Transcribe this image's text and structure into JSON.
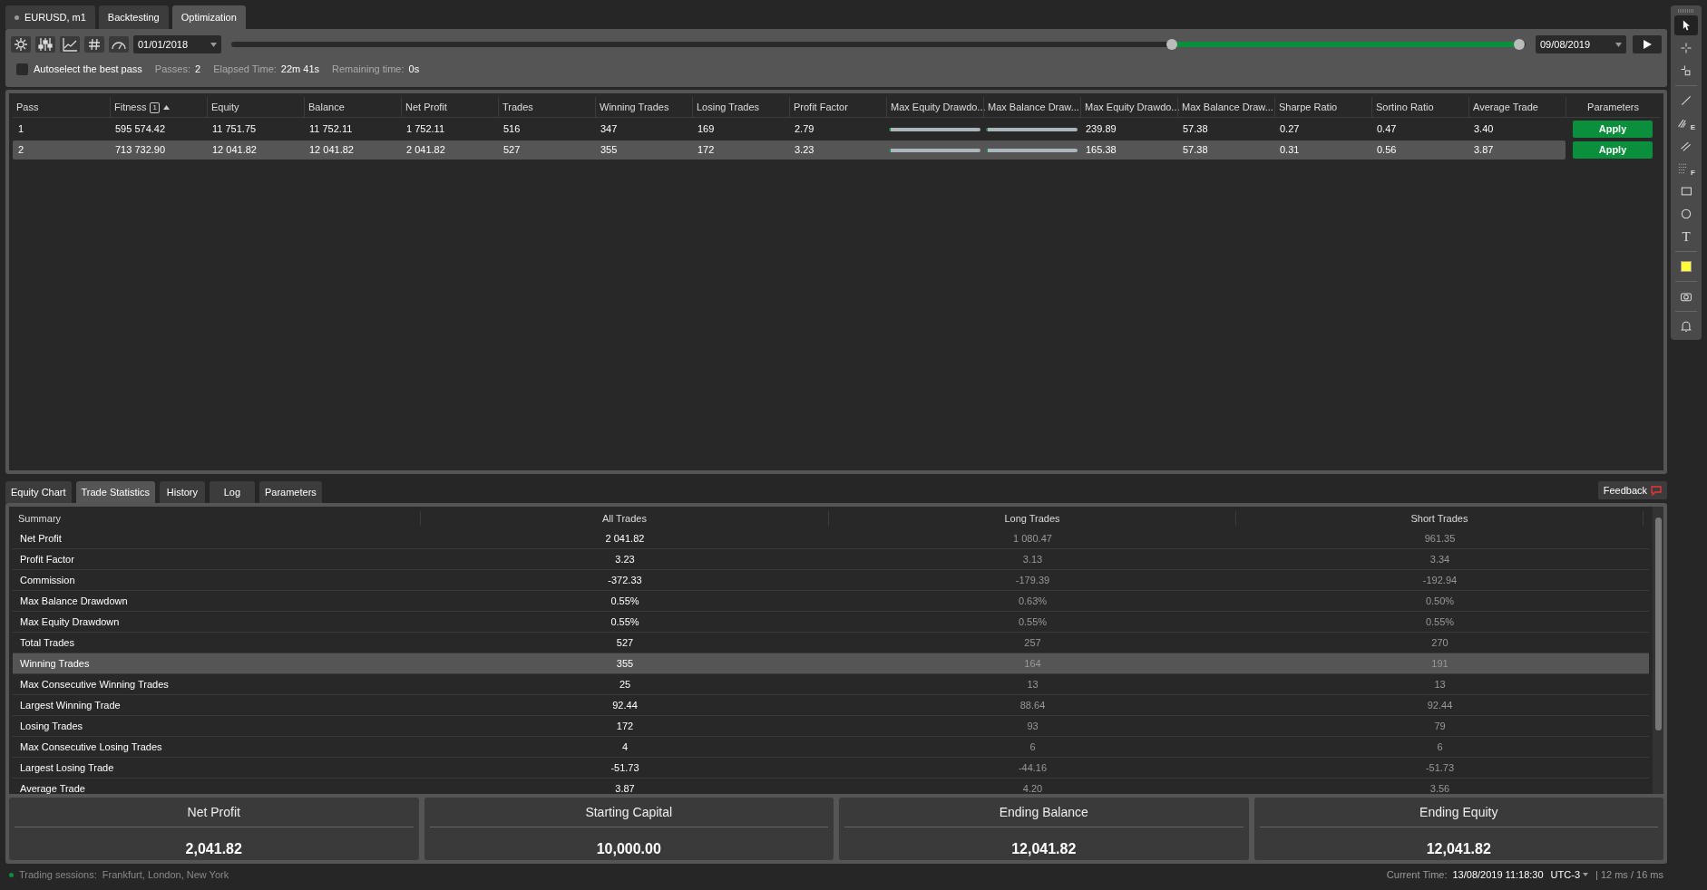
{
  "top_tabs": [
    {
      "label": "EURUSD, m1",
      "selected": false,
      "dot": true
    },
    {
      "label": "Backtesting",
      "selected": false
    },
    {
      "label": "Optimization",
      "selected": true
    }
  ],
  "toolbar": {
    "buttons": [
      {
        "kind": "gear"
      },
      {
        "kind": "sliders"
      },
      {
        "kind": "chart"
      },
      {
        "kind": "hash"
      },
      {
        "kind": "gauge"
      }
    ],
    "start_date": "01/01/2018",
    "end_date": "09/08/2019",
    "range": {
      "start_thumb": {
        "level": 0.727
      },
      "end_thumb": {
        "level": 0.995
      }
    },
    "autoselect": {
      "label": "Autoselect the best pass",
      "checked": false
    },
    "stats": [
      {
        "label": "Passes:",
        "value": "2"
      },
      {
        "label": "Elapsed Time:",
        "value": "22m 41s"
      },
      {
        "label": "Remaining time:",
        "value": "0s"
      }
    ]
  },
  "tools": [
    {
      "kind": "pointer",
      "selected": true
    },
    {
      "kind": "crosshair",
      "selected": false
    },
    {
      "kind": "crosshair-box",
      "selected": false
    },
    {
      "kind": "line",
      "selected": false
    },
    {
      "kind": "hatch",
      "selected": false,
      "label": "E"
    },
    {
      "kind": "parallel",
      "selected": false
    },
    {
      "kind": "grid",
      "selected": false,
      "label": "F"
    },
    {
      "kind": "rectangle",
      "selected": false
    },
    {
      "kind": "circle",
      "selected": false
    },
    {
      "kind": "text",
      "selected": false,
      "label": "T"
    },
    {
      "kind": "color",
      "selected": false,
      "color": "#ffff33"
    },
    {
      "kind": "camera",
      "selected": false
    },
    {
      "kind": "bell",
      "selected": false
    }
  ],
  "passes_table": {
    "columns": [
      {
        "label": "Pass"
      },
      {
        "label": "Fitness",
        "sort_badge": "1",
        "sorted": true
      },
      {
        "label": "Equity"
      },
      {
        "label": "Balance"
      },
      {
        "label": "Net Profit"
      },
      {
        "label": "Trades"
      },
      {
        "label": "Winning Trades"
      },
      {
        "label": "Losing Trades"
      },
      {
        "label": "Profit Factor"
      },
      {
        "label": "Max Equity Drawdo..."
      },
      {
        "label": "Max Balance Draw..."
      },
      {
        "label": "Max Equity Drawdo..."
      },
      {
        "label": "Max Balance Draw..."
      },
      {
        "label": "Sharpe Ratio"
      },
      {
        "label": "Sortino Ratio"
      },
      {
        "label": "Average Trade"
      }
    ],
    "parameters_heading": "Parameters",
    "rows": [
      {
        "selected": false,
        "cells": [
          "1",
          "595 574.42",
          "11 751.75",
          "11 752.11",
          "1 752.11",
          "516",
          "347",
          "169",
          "2.79",
          {
            "kind": "bar"
          },
          {
            "kind": "bar"
          },
          "239.89",
          "57.38",
          "0.27",
          "0.47",
          "3.40"
        ],
        "action": "Apply"
      },
      {
        "selected": true,
        "cells": [
          "2",
          "713 732.90",
          "12 041.82",
          "12 041.82",
          "2 041.82",
          "527",
          "355",
          "172",
          "3.23",
          {
            "kind": "bar"
          },
          {
            "kind": "bar"
          },
          "165.38",
          "57.38",
          "0.31",
          "0.56",
          "3.87"
        ],
        "action": "Apply"
      }
    ]
  },
  "bottom_tabs": [
    {
      "label": "Equity Chart",
      "selected": false
    },
    {
      "label": "Trade Statistics",
      "selected": true
    },
    {
      "label": "History",
      "selected": false
    },
    {
      "label": "Log",
      "selected": false
    },
    {
      "label": "Parameters",
      "selected": false
    }
  ],
  "feedback_button": "Feedback",
  "trade_statistics": {
    "columns": [
      "Summary",
      "All Trades",
      "Long Trades",
      "Short Trades"
    ],
    "rows": [
      {
        "selected": false,
        "cells": [
          "Net Profit",
          "2 041.82",
          "1 080.47",
          "961.35"
        ]
      },
      {
        "selected": false,
        "cells": [
          "Profit Factor",
          "3.23",
          "3.13",
          "3.34"
        ]
      },
      {
        "selected": false,
        "cells": [
          "Commission",
          "-372.33",
          "-179.39",
          "-192.94"
        ]
      },
      {
        "selected": false,
        "cells": [
          "Max Balance Drawdown",
          "0.55%",
          "0.63%",
          "0.50%"
        ]
      },
      {
        "selected": false,
        "cells": [
          "Max Equity Drawdown",
          "0.55%",
          "0.55%",
          "0.55%"
        ]
      },
      {
        "selected": false,
        "cells": [
          "Total Trades",
          "527",
          "257",
          "270"
        ]
      },
      {
        "selected": true,
        "cells": [
          "Winning Trades",
          "355",
          "164",
          "191"
        ]
      },
      {
        "selected": false,
        "cells": [
          "Max Consecutive Winning Trades",
          "25",
          "13",
          "13"
        ]
      },
      {
        "selected": false,
        "cells": [
          "Largest Winning Trade",
          "92.44",
          "88.64",
          "92.44"
        ]
      },
      {
        "selected": false,
        "cells": [
          "Losing Trades",
          "172",
          "93",
          "79"
        ]
      },
      {
        "selected": false,
        "cells": [
          "Max Consecutive Losing Trades",
          "4",
          "6",
          "6"
        ]
      },
      {
        "selected": false,
        "cells": [
          "Largest Losing Trade",
          "-51.73",
          "-44.16",
          "-51.73"
        ]
      },
      {
        "selected": false,
        "cells": [
          "Average Trade",
          "3.87",
          "4.20",
          "3.56"
        ]
      }
    ]
  },
  "summary_cards": [
    {
      "title": "Net Profit",
      "value": "2,041.82"
    },
    {
      "title": "Starting Capital",
      "value": "10,000.00"
    },
    {
      "title": "Ending Balance",
      "value": "12,041.82"
    },
    {
      "title": "Ending Equity",
      "value": "12,041.82"
    }
  ],
  "status_bar": {
    "sessions_label": "Trading sessions:",
    "sessions": "Frankfurt, London, New York",
    "time_label": "Current Time:",
    "time": "13/08/2019 11:18:30",
    "timezone": "UTC-3",
    "latency": "| 12 ms / 16 ms"
  }
}
